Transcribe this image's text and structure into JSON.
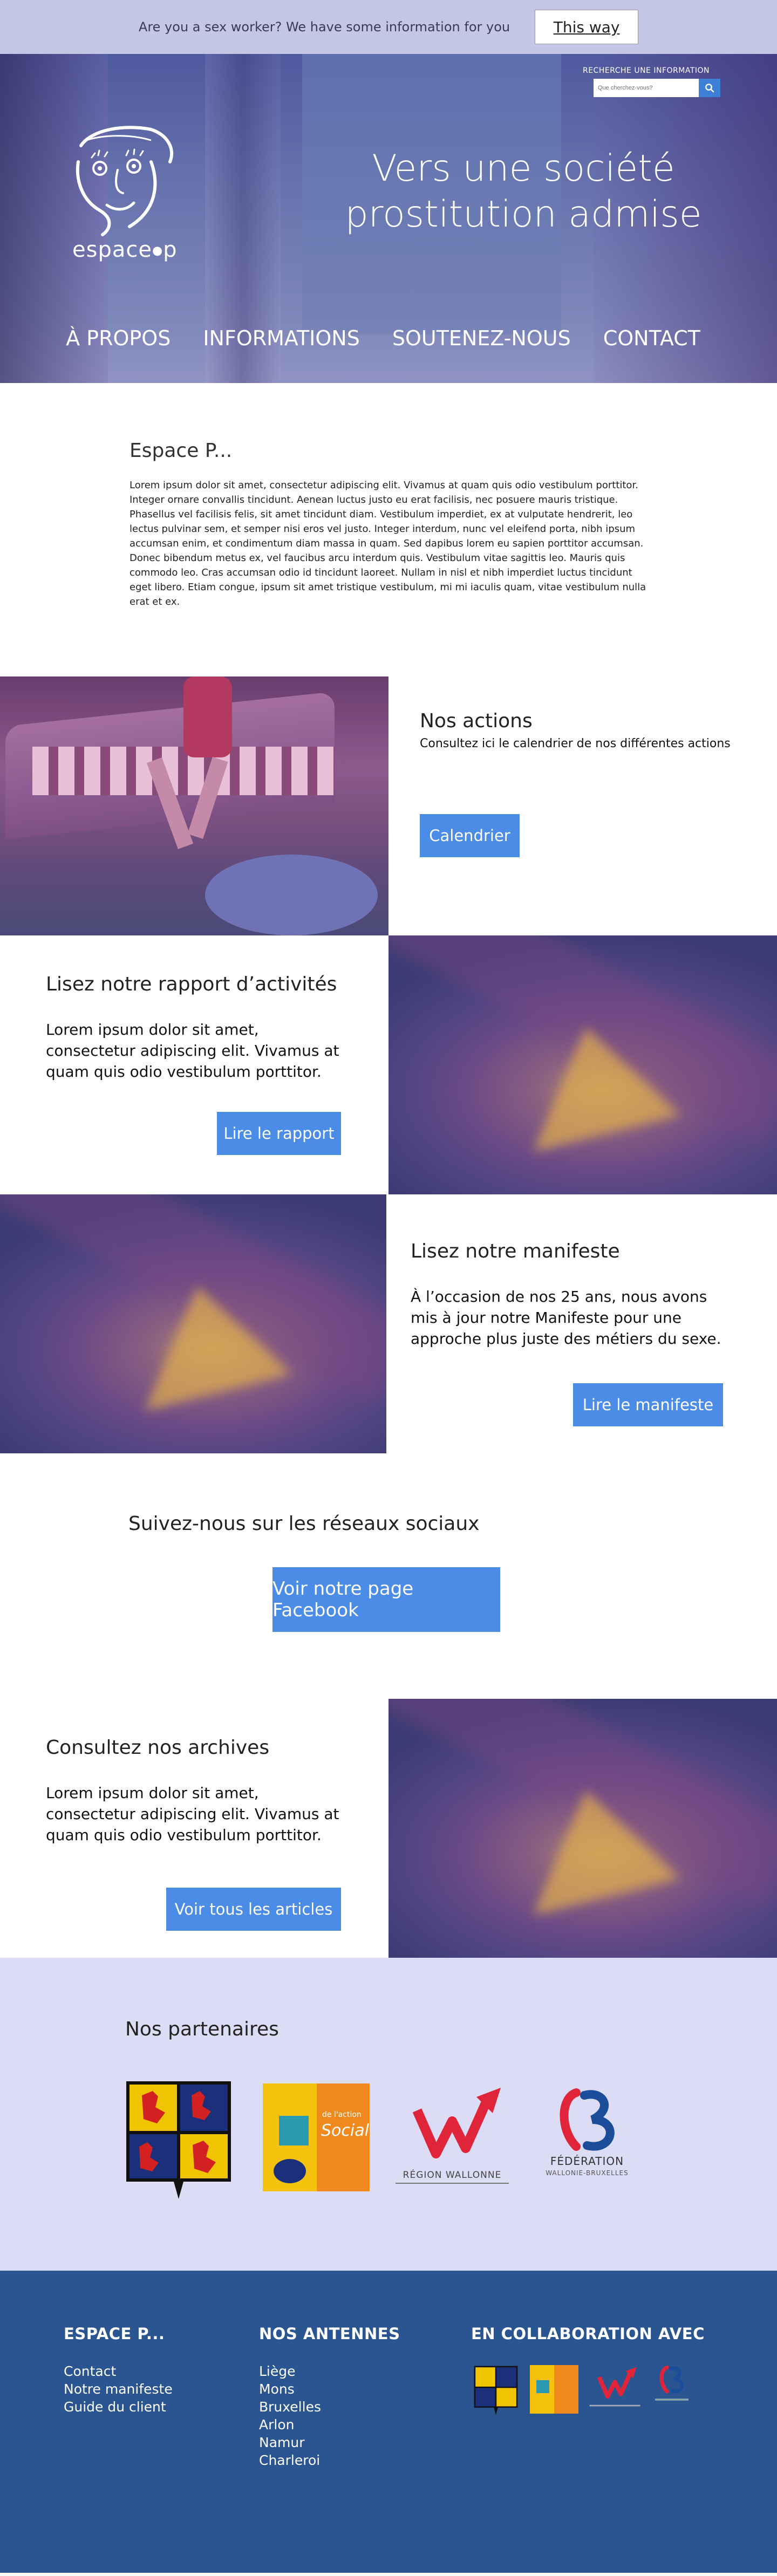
{
  "topbar": {
    "question": "Are you a sex worker? We have some information for you",
    "button": "This way"
  },
  "hero": {
    "search_label": "RECHERCHE UNE INFORMATION",
    "search_placeholder": "Que cherchez-vous?",
    "logo_text": "espace",
    "logo_letter": "p",
    "title": "Vers une société prostitution admise",
    "nav": [
      "À PROPOS",
      "INFORMATIONS",
      "SOUTENEZ-NOUS",
      "CONTACT"
    ]
  },
  "intro": {
    "title": "Espace P...",
    "body": "Lorem ipsum dolor sit amet, consectetur adipiscing elit. Vivamus at quam quis odio vestibulum porttitor. Integer ornare convallis tincidunt. Aenean luctus justo eu erat facilisis, nec posuere mauris tristique. Phasellus vel facilisis felis, sit amet tincidunt diam. Vestibulum imperdiet, ex at vulputate hendrerit, leo lectus pulvinar sem, et semper nisi eros vel justo. Integer interdum, nunc vel eleifend porta, nibh ipsum accumsan enim, et condimentum diam massa in quam. Sed dapibus lorem eu sapien porttitor accumsan. Donec bibendum metus ex, vel faucibus arcu interdum quis. Vestibulum vitae sagittis leo. Mauris quis commodo leo. Cras accumsan odio id tincidunt laoreet. Nullam in nisl et nibh imperdiet luctus tincidunt eget libero. Etiam congue, ipsum sit amet tristique vestibulum, mi mi iaculis quam, vitae vestibulum nulla erat et ex."
  },
  "actions": {
    "title": "Nos actions",
    "subtitle": "Consultez ici le calendrier de nos différentes actions",
    "button": "Calendrier"
  },
  "report": {
    "title": "Lisez notre rapport d’activités",
    "body": "Lorem ipsum dolor sit amet, consectetur adipiscing elit. Vivamus at quam quis odio vestibulum porttitor.",
    "button": "Lire le rapport"
  },
  "manifest": {
    "title": "Lisez notre manifeste",
    "body": "À l’occasion de nos 25 ans, nous avons mis à jour notre Manifeste pour une approche plus juste des métiers du sexe.",
    "button": "Lire le manifeste"
  },
  "social": {
    "title": "Suivez-nous sur les réseaux sociaux",
    "button": "Voir notre page Facebook"
  },
  "archives": {
    "title": "Consultez nos archives",
    "body": "Lorem ipsum dolor sit amet, consectetur adipiscing elit. Vivamus at quam quis odio vestibulum porttitor.",
    "button": "Voir tous les articles"
  },
  "partners": {
    "title": "Nos partenaires",
    "social_logo_small": "de l'action",
    "social_logo_big": "Social",
    "wallonie_text": "RÉGION WALLONNE",
    "fwb_line1": "FÉDÉRATION",
    "fwb_line2": "WALLONIE-BRUXELLES"
  },
  "footer": {
    "col1_title": "ESPACE P...",
    "col1_links": [
      "Contact",
      "Notre manifeste",
      "Guide du client"
    ],
    "col2_title": "NOS ANTENNES",
    "col2_links": [
      "Liège",
      "Mons",
      "Bruxelles",
      "Arlon",
      "Namur",
      "Charleroi"
    ],
    "col3_title": "EN COLLABORATION AVEC"
  },
  "colors": {
    "accent_blue": "#4a8ce6",
    "footer_bg": "#2b5590",
    "partners_bg": "#dcdcf4",
    "topbar_bg": "#c3c6e4"
  },
  "icons": [
    "search-icon",
    "espace-p-logo",
    "wallonia-coat-of-arms-logo",
    "action-sociale-logo",
    "region-wallonne-logo",
    "fwb-logo"
  ]
}
